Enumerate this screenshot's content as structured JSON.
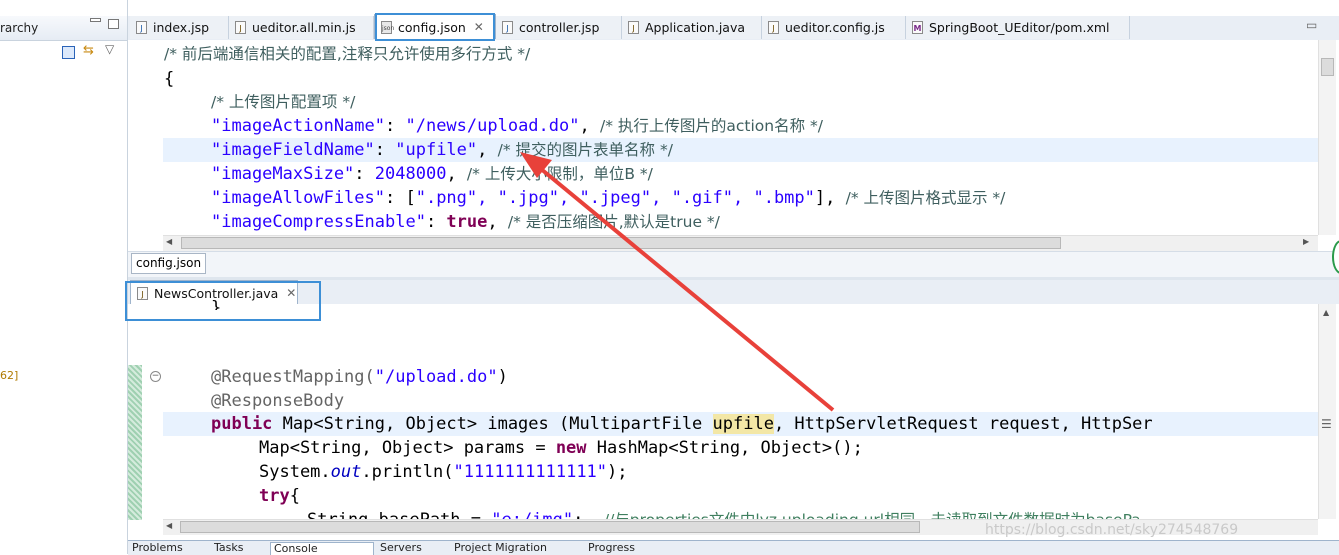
{
  "left_pane": {
    "title": "rarchy",
    "line_number": "62]"
  },
  "top_tabs": [
    {
      "label": "index.jsp",
      "icon": "jsp-file-icon",
      "active": false
    },
    {
      "label": "ueditor.all.min.js",
      "icon": "js-file-icon",
      "active": false
    },
    {
      "label": "config.json",
      "icon": "json-file-icon",
      "active": true,
      "close": "✕"
    },
    {
      "label": "controller.jsp",
      "icon": "jsp-file-icon",
      "active": false
    },
    {
      "label": "Application.java",
      "icon": "java-file-icon",
      "active": false
    },
    {
      "label": "ueditor.config.js",
      "icon": "js-file-icon",
      "active": false
    },
    {
      "label": "SpringBoot_UEditor/pom.xml",
      "icon": "xml-file-icon",
      "active": false
    }
  ],
  "top_code": {
    "l1": "/* 前后端通信相关的配置,注释只允许使用多行方式 */",
    "l2": "{",
    "l3": "/* 上传图片配置项 */",
    "l4": {
      "key": "\"imageActionName\"",
      "colon": ": ",
      "val": "\"/news/upload.do\"",
      "punct": ", ",
      "cm": "/* 执行上传图片的action名称 */"
    },
    "l5": {
      "key": "\"imageFieldName\"",
      "colon": ": ",
      "val": "\"upfile\"",
      "punct": ", ",
      "cm": "/* 提交的图片表单名称 */"
    },
    "l6": {
      "key": "\"imageMaxSize\"",
      "colon": ": ",
      "val": "2048000",
      "punct": ", ",
      "cm": "/* 上传大小限制，单位B */"
    },
    "l7": {
      "key": "\"imageAllowFiles\"",
      "colon": ": [",
      "val": "\".png\", \".jpg\", \".jpeg\", \".gif\", \".bmp\"",
      "punct": "], ",
      "cm": "/* 上传图片格式显示 */"
    },
    "l8": {
      "key": "\"imageCompressEnable\"",
      "colon": ": ",
      "val": "true",
      "punct": ", ",
      "cm": "/* 是否压缩图片,默认是true */"
    }
  },
  "breadcrumb": "config.json",
  "bottom_tab": {
    "label": "NewsController.java",
    "close": "✕"
  },
  "bottom_code": {
    "l0": "}",
    "l1": {
      "ann": "@RequestMapping(",
      "str": "\"/upload.do\"",
      "end": ")"
    },
    "l2": "@ResponseBody",
    "l3": {
      "kw": "public",
      "a": " Map<String, Object> images (MultipartFile ",
      "hl": "upfile",
      "b": ", HttpServletRequest request, HttpSer"
    },
    "l4": {
      "a": "Map<String, Object> params = ",
      "kw": "new",
      "b": " HashMap<String, Object>();"
    },
    "l5": {
      "a": "System.",
      "it": "out",
      "b": ".println(",
      "str": "\"1111111111111\"",
      "c": ");"
    },
    "l6": {
      "kw": "try",
      "a": "{"
    },
    "l7": {
      "a": "String basePath = ",
      "str": "\"e:/img\"",
      "b": ";  ",
      "cm": "//与properties文件中lyz.uploading.url相同，未读取到文件数据时为basePa"
    }
  },
  "views_tabs": [
    "Problems",
    "Tasks",
    "Console",
    "Servers",
    "Project Migration",
    "Progress"
  ],
  "watermark": "https://blog.csdn.net/sky274548769",
  "colors": {
    "arrow": "#e8413a",
    "box": "#3d8fd6",
    "keyword": "#7f0055",
    "string": "#2a00ff"
  }
}
